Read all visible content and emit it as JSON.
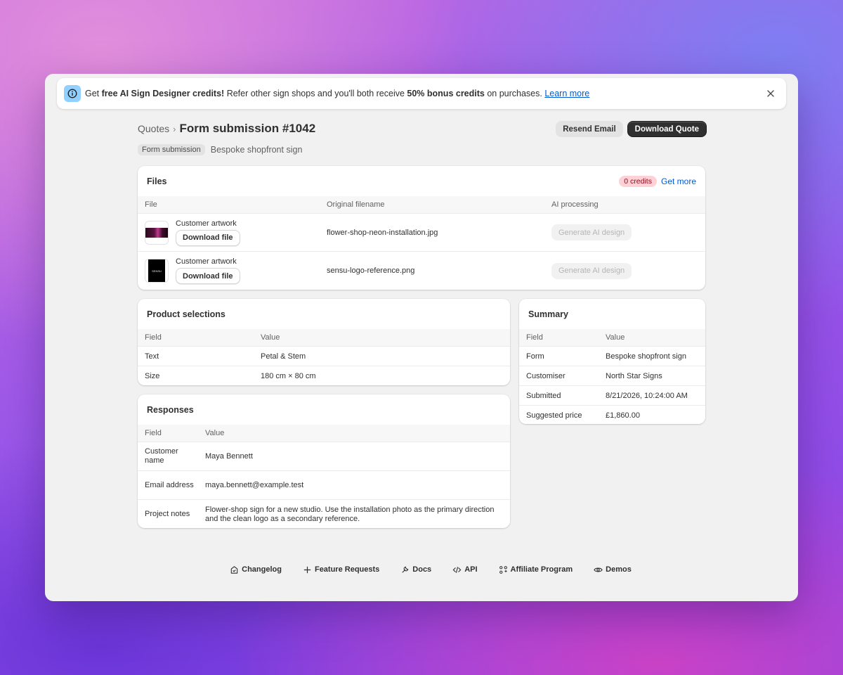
{
  "banner": {
    "text_get": "Get ",
    "text_bold1": "free AI Sign Designer credits!",
    "text_mid": " Refer other sign shops and you'll both receive ",
    "text_bold2": "50% bonus credits",
    "text_end": " on purchases. ",
    "link": "Learn more"
  },
  "header": {
    "breadcrumb": "Quotes",
    "title": "Form submission #1042",
    "tag": "Form submission",
    "subtitle": "Bespoke shopfront sign",
    "resend_label": "Resend Email",
    "download_label": "Download Quote"
  },
  "files": {
    "title": "Files",
    "credits": "0 credits",
    "get_more": "Get more",
    "columns": [
      "File",
      "Original filename",
      "AI processing"
    ],
    "rows": [
      {
        "label": "Customer artwork",
        "download": "Download file",
        "filename": "flower-shop-neon-installation.jpg",
        "action": "Generate AI design"
      },
      {
        "label": "Customer artwork",
        "download": "Download file",
        "filename": "sensu-logo-reference.png",
        "action": "Generate AI design"
      }
    ]
  },
  "products": {
    "title": "Product selections",
    "columns": [
      "Field",
      "Value"
    ],
    "rows": [
      {
        "field": "Text",
        "value": "Petal & Stem"
      },
      {
        "field": "Size",
        "value": "180 cm × 80 cm"
      }
    ]
  },
  "responses": {
    "title": "Responses",
    "columns": [
      "Field",
      "Value"
    ],
    "rows": [
      {
        "field": "Customer name",
        "value": "Maya Bennett"
      },
      {
        "field": "Email address",
        "value": "maya.bennett@example.test"
      },
      {
        "field": "Project notes",
        "value": "Flower-shop sign for a new studio. Use the installation photo as the primary direction and the clean logo as a secondary reference."
      }
    ]
  },
  "summary": {
    "title": "Summary",
    "columns": [
      "Field",
      "Value"
    ],
    "rows": [
      {
        "field": "Form",
        "value": "Bespoke shopfront sign"
      },
      {
        "field": "Customiser",
        "value": "North Star Signs"
      },
      {
        "field": "Submitted",
        "value": "8/21/2026, 10:24:00 AM"
      },
      {
        "field": "Suggested price",
        "value": "£1,860.00"
      }
    ]
  },
  "footer": {
    "links": [
      "Changelog",
      "Feature Requests",
      "Docs",
      "API",
      "Affiliate Program",
      "Demos"
    ]
  },
  "colors": {
    "accent_link": "#005bd3",
    "primary_button": "#303030",
    "credits_badge_bg": "#fed1d7",
    "info_icon_bg": "#91d0ff"
  }
}
